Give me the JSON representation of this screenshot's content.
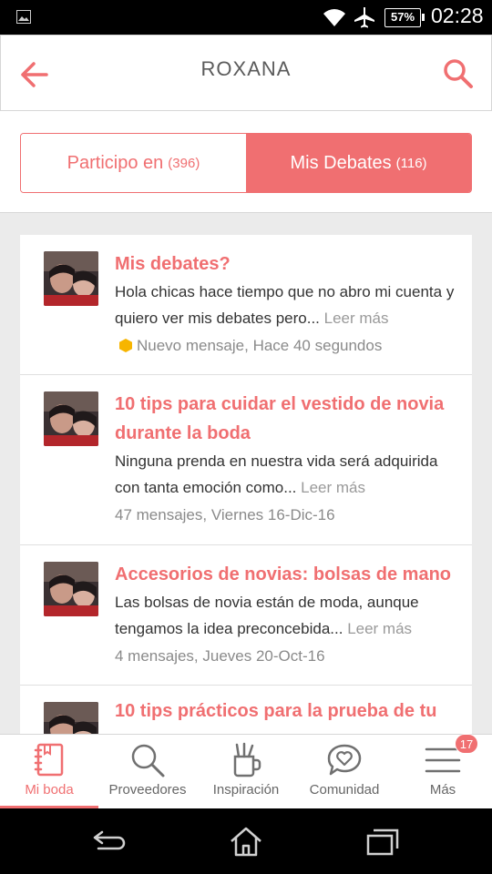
{
  "status_bar": {
    "battery": "57%",
    "time": "02:28"
  },
  "header": {
    "title": "ROXANA"
  },
  "tabs": [
    {
      "label": "Participo en",
      "count": "(396)",
      "active": false
    },
    {
      "label": "Mis Debates",
      "count": "(116)",
      "active": true
    }
  ],
  "debates": [
    {
      "title": "Mis debates?",
      "excerpt": "Hola chicas hace tiempo que no abro mi cuenta y quiero ver mis debates pero...",
      "read_more": "Leer más",
      "meta": "Nuevo mensaje, Hace 40 segundos",
      "new": true
    },
    {
      "title": "10 tips para cuidar el vestido de novia durante la boda",
      "excerpt": "Ninguna prenda en nuestra vida será adquirida con tanta emoción como...",
      "read_more": "Leer más",
      "meta": "47 mensajes, Viernes 16-Dic-16",
      "new": false
    },
    {
      "title": "Accesorios de novias: bolsas de mano",
      "excerpt": "Las bolsas de novia están de moda, aunque tengamos la idea preconcebida...",
      "read_more": "Leer más",
      "meta": "4 mensajes, Jueves 20-Oct-16",
      "new": false
    },
    {
      "title": "10 tips prácticos para la prueba de tu",
      "excerpt": "",
      "read_more": "",
      "meta": "",
      "new": false
    }
  ],
  "bottom_nav": [
    {
      "label": "Mi boda",
      "icon": "notebook-icon",
      "active": true
    },
    {
      "label": "Proveedores",
      "icon": "search-icon",
      "active": false
    },
    {
      "label": "Inspiración",
      "icon": "pencil-cup-icon",
      "active": false
    },
    {
      "label": "Comunidad",
      "icon": "chat-heart-icon",
      "active": false
    },
    {
      "label": "Más",
      "icon": "menu-icon",
      "active": false
    }
  ],
  "more_badge": "17",
  "colors": {
    "accent": "#f06f71",
    "new_dot": "#f7b500"
  }
}
